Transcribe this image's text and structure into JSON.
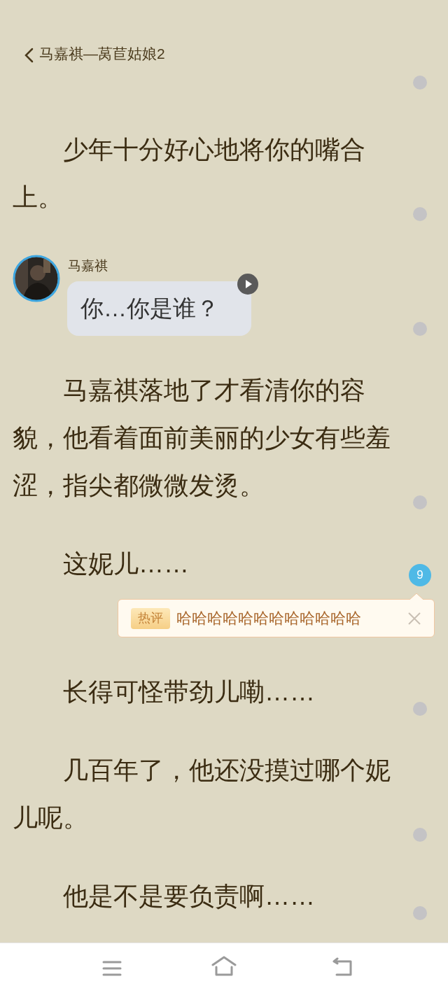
{
  "header": {
    "title": "马嘉祺—莴苣姑娘2"
  },
  "content": [
    {
      "kind": "paragraph",
      "text": "少年十分好心地将你的嘴合上。"
    },
    {
      "kind": "chat",
      "speaker": "马嘉祺",
      "message": "你…你是谁？"
    },
    {
      "kind": "paragraph",
      "text": "马嘉祺落地了才看清你的容貌，他看着面前美丽的少女有些羞涩，指尖都微微发烫。"
    },
    {
      "kind": "paragraph",
      "text": "这妮儿……",
      "comment_count": "9"
    },
    {
      "kind": "hot_comment",
      "badge": "热评",
      "text": "哈哈哈哈哈哈哈哈哈哈哈哈"
    },
    {
      "kind": "paragraph",
      "text": "长得可怪带劲儿嘞……"
    },
    {
      "kind": "paragraph",
      "text": "几百年了，他还没摸过哪个妮儿呢。"
    },
    {
      "kind": "paragraph",
      "text": "他是不是要负责啊……"
    }
  ]
}
